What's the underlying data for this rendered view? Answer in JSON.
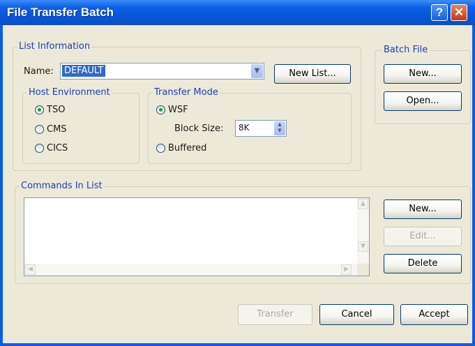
{
  "window": {
    "title": "File Transfer Batch"
  },
  "titlebar": {
    "help_glyph": "?",
    "close_glyph": "✕"
  },
  "list_info": {
    "legend": "List Information",
    "name_label": "Name:",
    "name_value": "DEFAULT",
    "new_list_label": "New List..."
  },
  "host_env": {
    "legend": "Host Environment",
    "options": [
      {
        "label": "TSO",
        "checked": true
      },
      {
        "label": "CMS",
        "checked": false
      },
      {
        "label": "CICS",
        "checked": false
      }
    ]
  },
  "transfer_mode": {
    "legend": "Transfer Mode",
    "wsf_label": "WSF",
    "wsf_checked": true,
    "block_size_label": "Block Size:",
    "block_size_value": "8K",
    "buffered_label": "Buffered",
    "buffered_checked": false
  },
  "batch_file": {
    "legend": "Batch File",
    "new_label": "New...",
    "open_label": "Open..."
  },
  "commands": {
    "legend": "Commands In List",
    "items": [],
    "new_label": "New...",
    "edit_label": "Edit...",
    "delete_label": "Delete"
  },
  "footer": {
    "transfer_label": "Transfer",
    "cancel_label": "Cancel",
    "accept_label": "Accept"
  },
  "icons": {
    "combo_arrow": "chevron-down-icon",
    "spin": "spin-arrows-icon",
    "help": "help-icon",
    "close": "close-icon"
  },
  "colors": {
    "titlebar": "#0a54d4",
    "window_bg": "#ece9d8",
    "legend_text": "#1d3eb9",
    "selection": "#316ac5",
    "close_button": "#c73a15"
  }
}
